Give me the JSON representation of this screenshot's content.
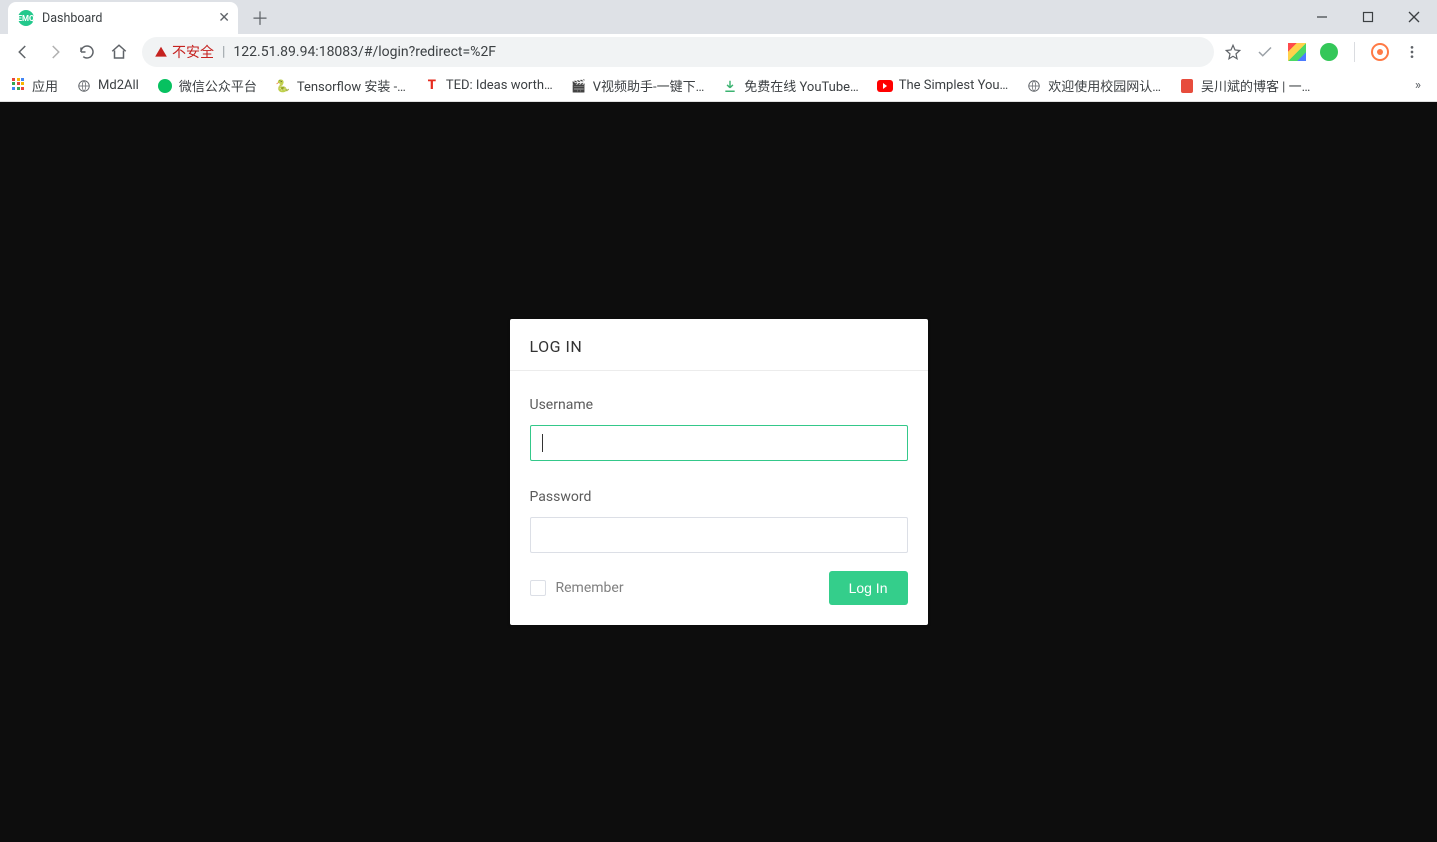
{
  "browser": {
    "tab_title": "Dashboard",
    "insecure_label": "不安全",
    "url": "122.51.89.94:18083/#/login?redirect=%2F"
  },
  "bookmarks": {
    "apps": "应用",
    "items": [
      {
        "label": "Md2All"
      },
      {
        "label": "微信公众平台"
      },
      {
        "label": "Tensorflow 安装 -…"
      },
      {
        "label": "TED: Ideas worth…"
      },
      {
        "label": "V视频助手-一键下…"
      },
      {
        "label": "免费在线 YouTube…"
      },
      {
        "label": "The Simplest You…"
      },
      {
        "label": "欢迎使用校园网认…"
      },
      {
        "label": "吴川斌的博客 | 一…"
      }
    ]
  },
  "login": {
    "title": "LOG IN",
    "username_label": "Username",
    "username_value": "",
    "password_label": "Password",
    "password_value": "",
    "remember_label": "Remember",
    "submit_label": "Log In"
  },
  "colors": {
    "page_bg": "#0d0d0d",
    "accent_green": "#34ce8b",
    "insecure_red": "#c5221f"
  }
}
